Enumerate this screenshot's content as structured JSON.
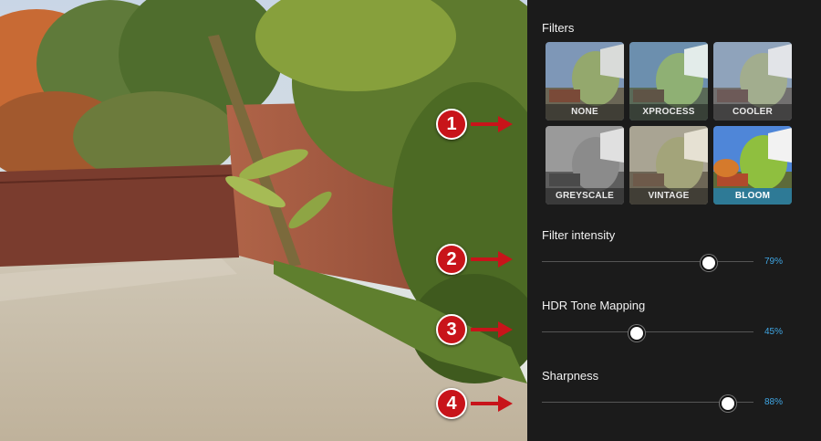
{
  "filters_title": "Filters",
  "filters": [
    {
      "label": "NONE",
      "selected": false,
      "tone": "none"
    },
    {
      "label": "XPROCESS",
      "selected": false,
      "tone": "xprocess"
    },
    {
      "label": "COOLER",
      "selected": false,
      "tone": "cooler"
    },
    {
      "label": "GREYSCALE",
      "selected": false,
      "tone": "greyscale"
    },
    {
      "label": "VINTAGE",
      "selected": false,
      "tone": "vintage"
    },
    {
      "label": "BLOOM",
      "selected": true,
      "tone": "bloom"
    }
  ],
  "sliders": [
    {
      "label": "Filter intensity",
      "value": 79,
      "value_text": "79%"
    },
    {
      "label": "HDR Tone Mapping",
      "value": 45,
      "value_text": "45%"
    },
    {
      "label": "Sharpness",
      "value": 88,
      "value_text": "88%"
    }
  ],
  "callouts": [
    "1",
    "2",
    "3",
    "4"
  ],
  "accent_color": "#3fa6e4",
  "selected_color": "#2e7a96",
  "callout_color": "#c8141a"
}
